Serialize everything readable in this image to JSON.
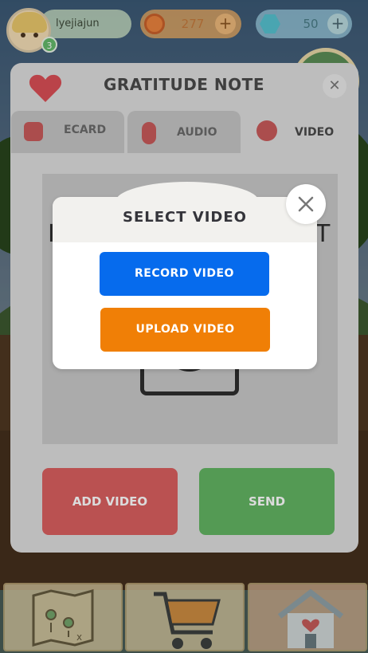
{
  "hud": {
    "username": "lyejiajun",
    "level": "3",
    "coins": "277",
    "gems": "50",
    "coins_add": "+",
    "gems_add": "+"
  },
  "note": {
    "title": "GRATITUDE NOTE",
    "close": "✕",
    "tabs": [
      {
        "label": "ECARD",
        "icon": "card-icon"
      },
      {
        "label": "AUDIO",
        "icon": "microphone-icon"
      },
      {
        "label": "VIDEO",
        "icon": "video-camera-icon"
      }
    ],
    "active_tab": "VIDEO",
    "stray_left": "I",
    "stray_right": "T",
    "add_video": "ADD VIDEO",
    "send": "SEND"
  },
  "modal": {
    "title": "SELECT VIDEO",
    "record": "RECORD VIDEO",
    "upload": "UPLOAD VIDEO"
  },
  "colors": {
    "record": "#066bed",
    "upload": "#f07f06",
    "add_video": "#d95f5f",
    "send": "#62b462"
  }
}
